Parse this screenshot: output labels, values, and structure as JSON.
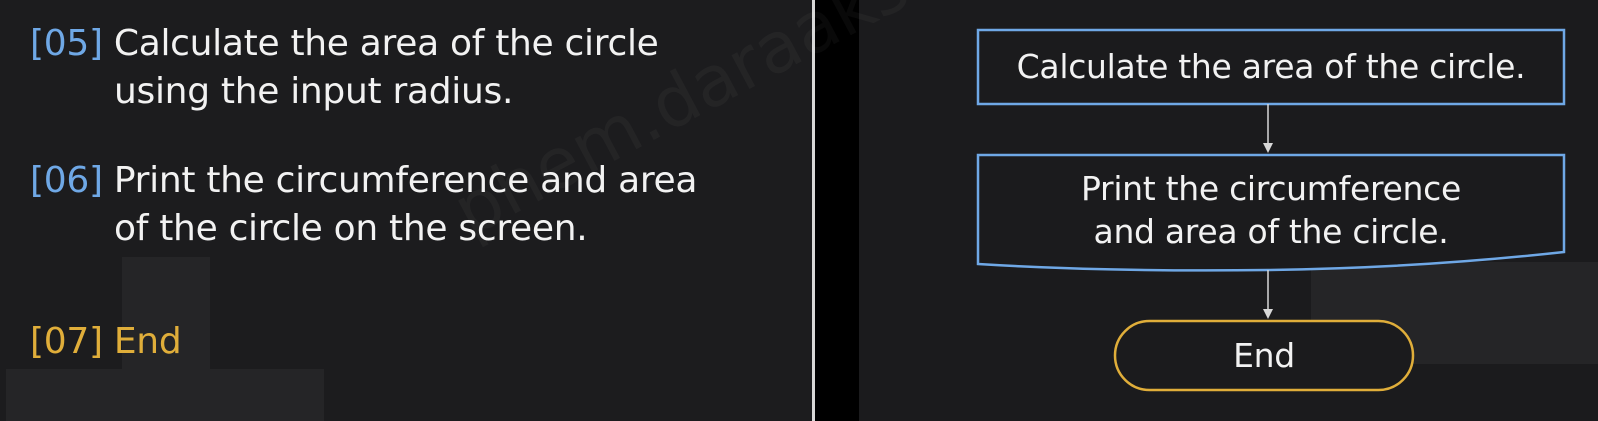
{
  "steps": [
    {
      "num": "[05]",
      "line1": "Calculate the area of the circle",
      "line2": "using the input radius."
    },
    {
      "num": "[06]",
      "line1": "Print the circumference and area",
      "line2": "of the circle on the screen."
    },
    {
      "num": "[07]",
      "line1": "End"
    }
  ],
  "flowchart": {
    "process": "Calculate the area of the circle.",
    "output_line1": "Print the circumference",
    "output_line2": "and area of the circle.",
    "terminator": "End"
  },
  "watermark": "phem.daraaksmey@gmail.com",
  "colors": {
    "step_number": "#6fa8e6",
    "box_border": "#6fa8e6",
    "end_accent": "#e0ae3a",
    "text": "#f2f2f2",
    "arrow": "#d8d8d8"
  }
}
